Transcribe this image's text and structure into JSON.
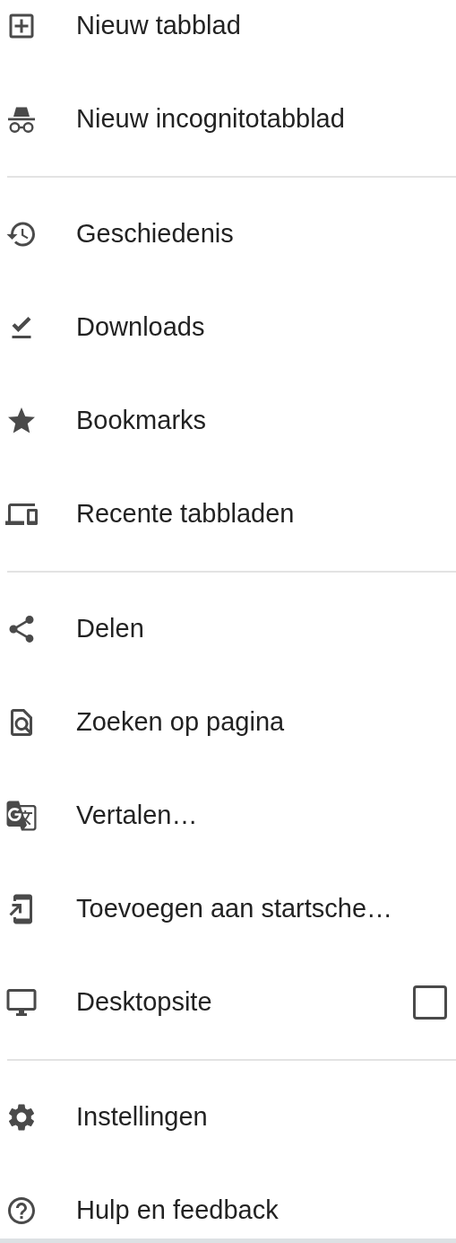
{
  "menu": {
    "sections": [
      {
        "items": [
          {
            "kind": "action",
            "label": "Nieuw tabblad"
          },
          {
            "kind": "action",
            "label": "Nieuw incognitotabblad"
          }
        ]
      },
      {
        "items": [
          {
            "kind": "action",
            "label": "Geschiedenis"
          },
          {
            "kind": "action",
            "label": "Downloads"
          },
          {
            "kind": "action",
            "label": "Bookmarks"
          },
          {
            "kind": "action",
            "label": "Recente tabbladen"
          }
        ]
      },
      {
        "items": [
          {
            "kind": "action",
            "label": "Delen"
          },
          {
            "kind": "action",
            "label": "Zoeken op pagina"
          },
          {
            "kind": "action",
            "label": "Vertalen…"
          },
          {
            "kind": "action",
            "label": "Toevoegen aan startsche…"
          },
          {
            "kind": "checkbox",
            "label": "Desktopsite",
            "checked": false
          }
        ]
      },
      {
        "items": [
          {
            "kind": "action",
            "label": "Instellingen"
          },
          {
            "kind": "action",
            "label": "Hulp en feedback"
          }
        ]
      }
    ]
  }
}
